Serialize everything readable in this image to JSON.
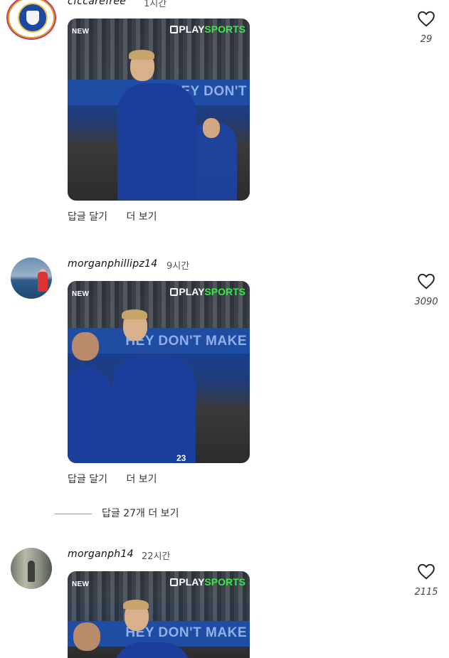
{
  "comments": [
    {
      "username": "cfccarefree",
      "time": "1시간",
      "avatar_badge": "CHELSEA CAREFREE",
      "media": {
        "new_label": "NEW",
        "logo_play": "PLAY",
        "logo_sports": "SPORTS",
        "banner": "THEY DON'T"
      },
      "actions": {
        "reply": "답글 달기",
        "more": "더 보기"
      },
      "like_count": "29"
    },
    {
      "username": "morganphillipz14",
      "time": "9시간",
      "media": {
        "new_label": "NEW",
        "logo_play": "PLAY",
        "logo_sports": "SPORTS",
        "banner": "HEY DON'T MAKE",
        "jersey_number": "23"
      },
      "actions": {
        "reply": "답글 달기",
        "more": "더 보기"
      },
      "like_count": "3090"
    },
    {
      "username": "morganph14",
      "time": "22시간",
      "media": {
        "new_label": "NEW",
        "logo_play": "PLAY",
        "logo_sports": "SPORTS",
        "banner": "HEY DON'T MAKE"
      },
      "like_count": "2115"
    }
  ],
  "more_replies": "답글 27개 더 보기",
  "colors": {
    "logo_green": "#3ce64a",
    "jersey_blue": "#1a3e9a",
    "banner_blue": "#1f4da3"
  },
  "icons": {
    "like": "heart-outline-icon"
  }
}
